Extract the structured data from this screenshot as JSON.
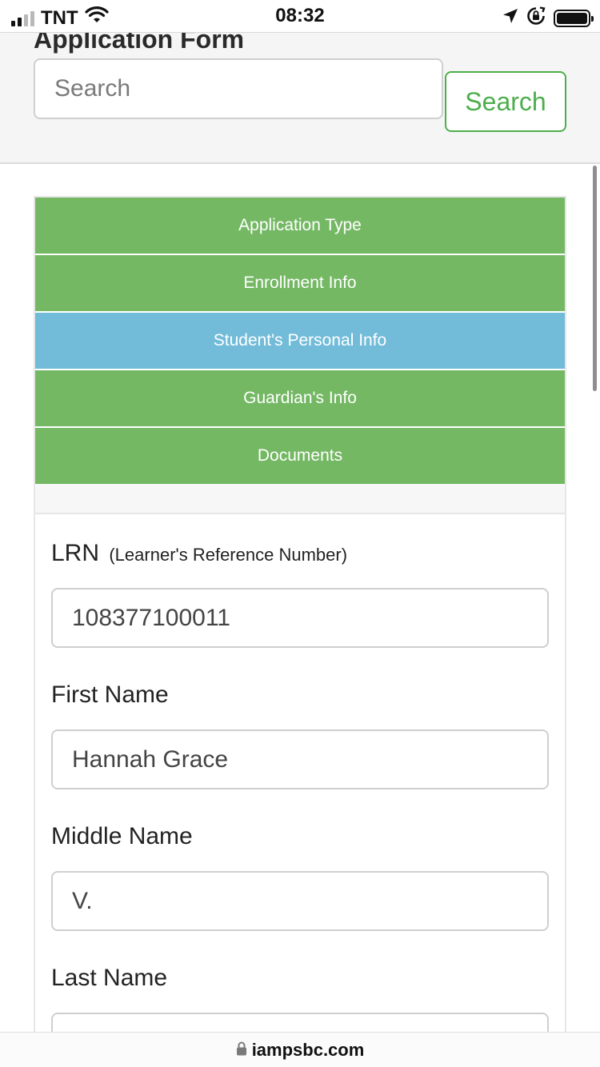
{
  "status_bar": {
    "carrier": "TNT",
    "time": "08:32",
    "icons": [
      "signal-icon",
      "wifi-icon",
      "location-arrow-icon",
      "rotation-lock-icon",
      "battery-icon"
    ]
  },
  "header": {
    "title": "Application Form",
    "search": {
      "placeholder": "Search",
      "button_label": "Search"
    }
  },
  "tabs": [
    {
      "label": "Application Type",
      "active": false
    },
    {
      "label": "Enrollment Info",
      "active": false
    },
    {
      "label": "Student's Personal Info",
      "active": true
    },
    {
      "label": "Guardian's Info",
      "active": false
    },
    {
      "label": "Documents",
      "active": false
    }
  ],
  "form": {
    "lrn": {
      "label": "LRN",
      "hint": "(Learner's Reference Number)",
      "value": "108377100011"
    },
    "first_name": {
      "label": "First Name",
      "value": "Hannah Grace"
    },
    "middle_name": {
      "label": "Middle Name",
      "value": "V."
    },
    "last_name": {
      "label": "Last Name",
      "value": ""
    }
  },
  "browser": {
    "domain": "iampsbc.com",
    "icon": "lock-icon"
  },
  "colors": {
    "tab_green": "#74b864",
    "tab_active_blue": "#72bcd9",
    "search_button_green": "#4cae4c"
  }
}
